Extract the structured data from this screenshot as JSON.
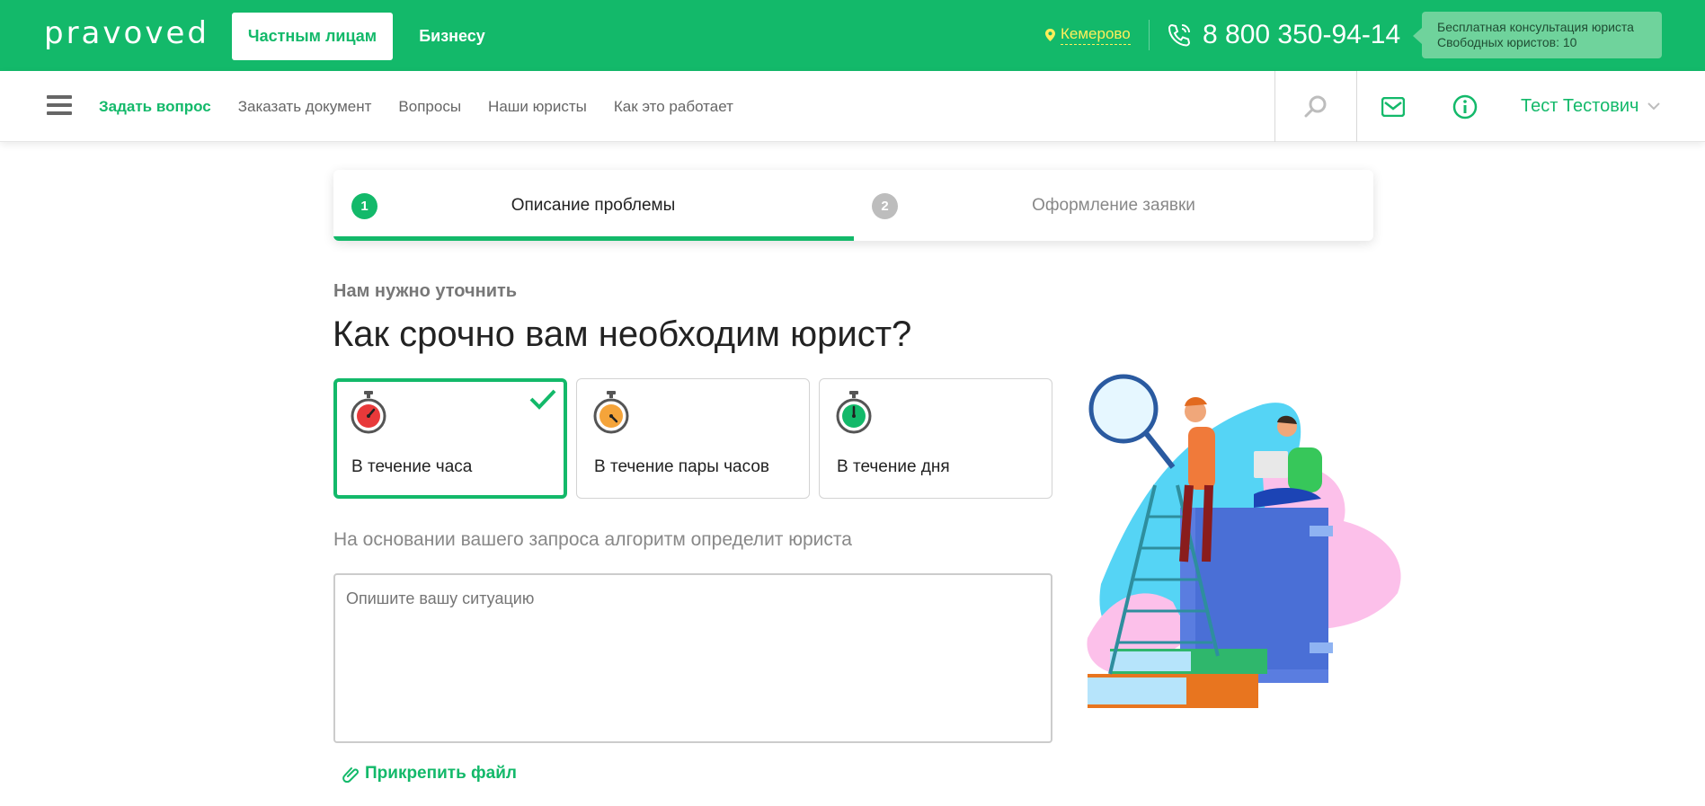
{
  "header": {
    "logo": "pravoved",
    "segments": {
      "private": "Частным лицам",
      "business": "Бизнесу"
    },
    "city": "Кемерово",
    "phone": "8 800 350-94-14",
    "consult": {
      "line1": "Бесплатная консультация юриста",
      "line2": "Свободных юристов: 10"
    }
  },
  "nav": {
    "items": [
      {
        "label": "Задать вопрос"
      },
      {
        "label": "Заказать документ"
      },
      {
        "label": "Вопросы"
      },
      {
        "label": "Наши юристы"
      },
      {
        "label": "Как это работает"
      }
    ],
    "user": "Тест Тестович"
  },
  "steps": [
    {
      "num": "1",
      "label": "Описание проблемы",
      "active": true
    },
    {
      "num": "2",
      "label": "Оформление заявки",
      "active": false
    }
  ],
  "form": {
    "kicker": "Нам нужно уточнить",
    "headline": "Как срочно вам необходим юрист?",
    "options": [
      {
        "label": "В течение часа",
        "selected": true,
        "color": "#e8393a"
      },
      {
        "label": "В течение пары часов",
        "selected": false,
        "color": "#f5a43a"
      },
      {
        "label": "В течение дня",
        "selected": false,
        "color": "#13b96a"
      }
    ],
    "hint": "На основании вашего запроса алгоритм определит юриста",
    "textarea_placeholder": "Опишите вашу ситуацию",
    "attach": "Прикрепить файл"
  },
  "colors": {
    "brand": "#13b96a",
    "city": "#ffef5a",
    "step_inactive": "#bdbdbd"
  }
}
